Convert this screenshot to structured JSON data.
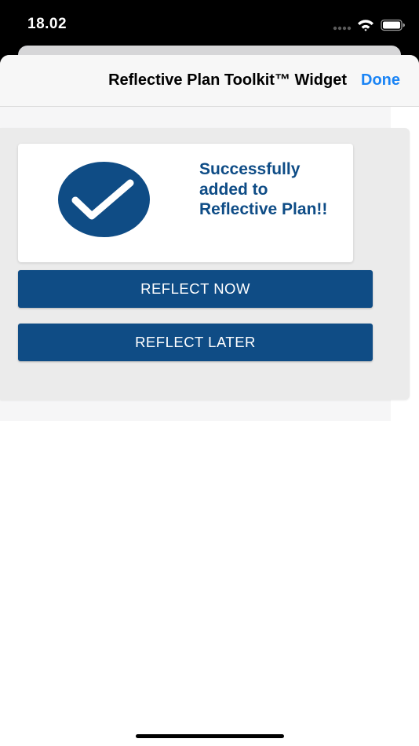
{
  "status_bar": {
    "time": "18.02",
    "signal_icon": "signal-dots-icon",
    "wifi_icon": "wifi-icon",
    "battery_icon": "battery-full-icon"
  },
  "nav": {
    "title": "Reflective Plan Toolkit™ Widget",
    "done_label": "Done",
    "done_color": "#1a84f5"
  },
  "widget": {
    "success_icon": "checkmark-icon",
    "success_message": "Successfully added to Reflective Plan!!",
    "accent_color": "#0f4c85",
    "buttons": {
      "reflect_now": "REFLECT NOW",
      "reflect_later": "REFLECT LATER"
    }
  }
}
